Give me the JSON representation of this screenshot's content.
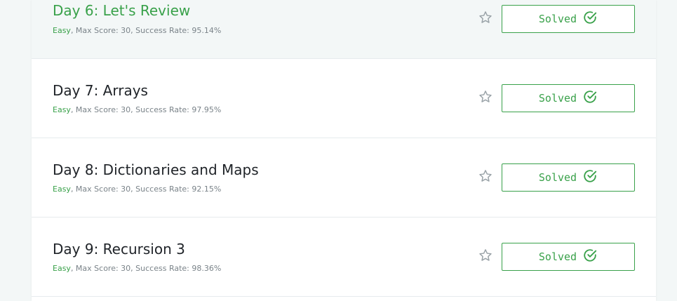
{
  "challenges": [
    {
      "title": "Day 6: Let's Review",
      "difficulty": "Easy",
      "details": ", Max Score: 30, Success Rate: 95.14%",
      "status_label": "Solved"
    },
    {
      "title": "Day 7: Arrays",
      "difficulty": "Easy",
      "details": ", Max Score: 30, Success Rate: 97.95%",
      "status_label": "Solved"
    },
    {
      "title": "Day 8: Dictionaries and Maps",
      "difficulty": "Easy",
      "details": ", Max Score: 30, Success Rate: 92.15%",
      "status_label": "Solved"
    },
    {
      "title": "Day 9: Recursion 3",
      "difficulty": "Easy",
      "details": ", Max Score: 30, Success Rate: 98.36%",
      "status_label": "Solved"
    }
  ],
  "colors": {
    "accent": "#39a14a",
    "text": "#1f2328",
    "muted": "#7a8389",
    "hover_bg": "#f3f7f7"
  },
  "icons": {
    "bookmark": "star-icon",
    "solved": "check-circle-icon"
  }
}
